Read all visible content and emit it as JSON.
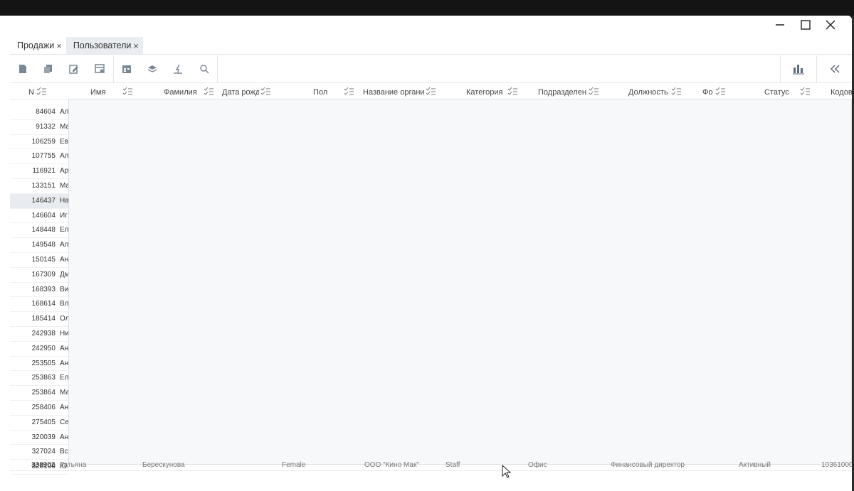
{
  "tabs": [
    {
      "label": "Продажи",
      "close": "×"
    },
    {
      "label": "Пользователи",
      "close": "×"
    }
  ],
  "columns": [
    {
      "label": "N"
    },
    {
      "label": "Имя"
    },
    {
      "label": "Фамилия"
    },
    {
      "label": "Дата рожд"
    },
    {
      "label": "Пол"
    },
    {
      "label": "Название органи"
    },
    {
      "label": "Категория"
    },
    {
      "label": "Подразделен"
    },
    {
      "label": "Должность"
    },
    {
      "label": "Фо"
    },
    {
      "label": "Статус"
    },
    {
      "label": "Кодов"
    }
  ],
  "rows": [
    {
      "id": "84604",
      "name_fragment": "Ал"
    },
    {
      "id": "91332",
      "name_fragment": "Ма"
    },
    {
      "id": "106259",
      "name_fragment": "Ев"
    },
    {
      "id": "107755",
      "name_fragment": "Ал"
    },
    {
      "id": "116921",
      "name_fragment": "Ар"
    },
    {
      "id": "133151",
      "name_fragment": "Ма"
    },
    {
      "id": "146437",
      "name_fragment": "На"
    },
    {
      "id": "146604",
      "name_fragment": "Иг"
    },
    {
      "id": "148448",
      "name_fragment": "Ел"
    },
    {
      "id": "149548",
      "name_fragment": "Ал"
    },
    {
      "id": "150145",
      "name_fragment": "Ан"
    },
    {
      "id": "167309",
      "name_fragment": "Дм"
    },
    {
      "id": "168393",
      "name_fragment": "Ви"
    },
    {
      "id": "168614",
      "name_fragment": "Вл"
    },
    {
      "id": "185414",
      "name_fragment": "Ол"
    },
    {
      "id": "242938",
      "name_fragment": "Ни"
    },
    {
      "id": "242950",
      "name_fragment": "Ан"
    },
    {
      "id": "253505",
      "name_fragment": "Ан"
    },
    {
      "id": "253863",
      "name_fragment": "Ел"
    },
    {
      "id": "253864",
      "name_fragment": "Ма"
    },
    {
      "id": "258406",
      "name_fragment": "Ан"
    },
    {
      "id": "275405",
      "name_fragment": "Се"
    },
    {
      "id": "320039",
      "name_fragment": "Ан"
    },
    {
      "id": "327024",
      "name_fragment": "Вс"
    },
    {
      "id": "328109",
      "name_fragment": "Ю."
    }
  ],
  "last_row": {
    "id": "338902",
    "first_name": "Татьяна",
    "last_name": "Берескунова",
    "gender": "Female",
    "org": "ООО \"Кино Мак\"",
    "category": "Staff",
    "dept": "Офис",
    "position": "Финансовый директор",
    "status": "Активный",
    "code": "10361000"
  },
  "selected_row_id": "146437",
  "icons": {
    "minimize": "minimize-icon",
    "maximize": "maximize-icon",
    "close": "close-icon",
    "toolbar": [
      "new-document-icon",
      "copy-icon",
      "edit-icon",
      "table-settings-icon",
      "calendar-icon",
      "layers-icon",
      "import-icon",
      "search-icon"
    ],
    "chart": "bar-chart-icon",
    "collapse": "double-chevron-left-icon",
    "filter": "filter-list-icon"
  },
  "colors": {
    "overlay": "#f7f8fa",
    "active_tab": "#e9edf1",
    "selected_row": "#e8ebef"
  }
}
